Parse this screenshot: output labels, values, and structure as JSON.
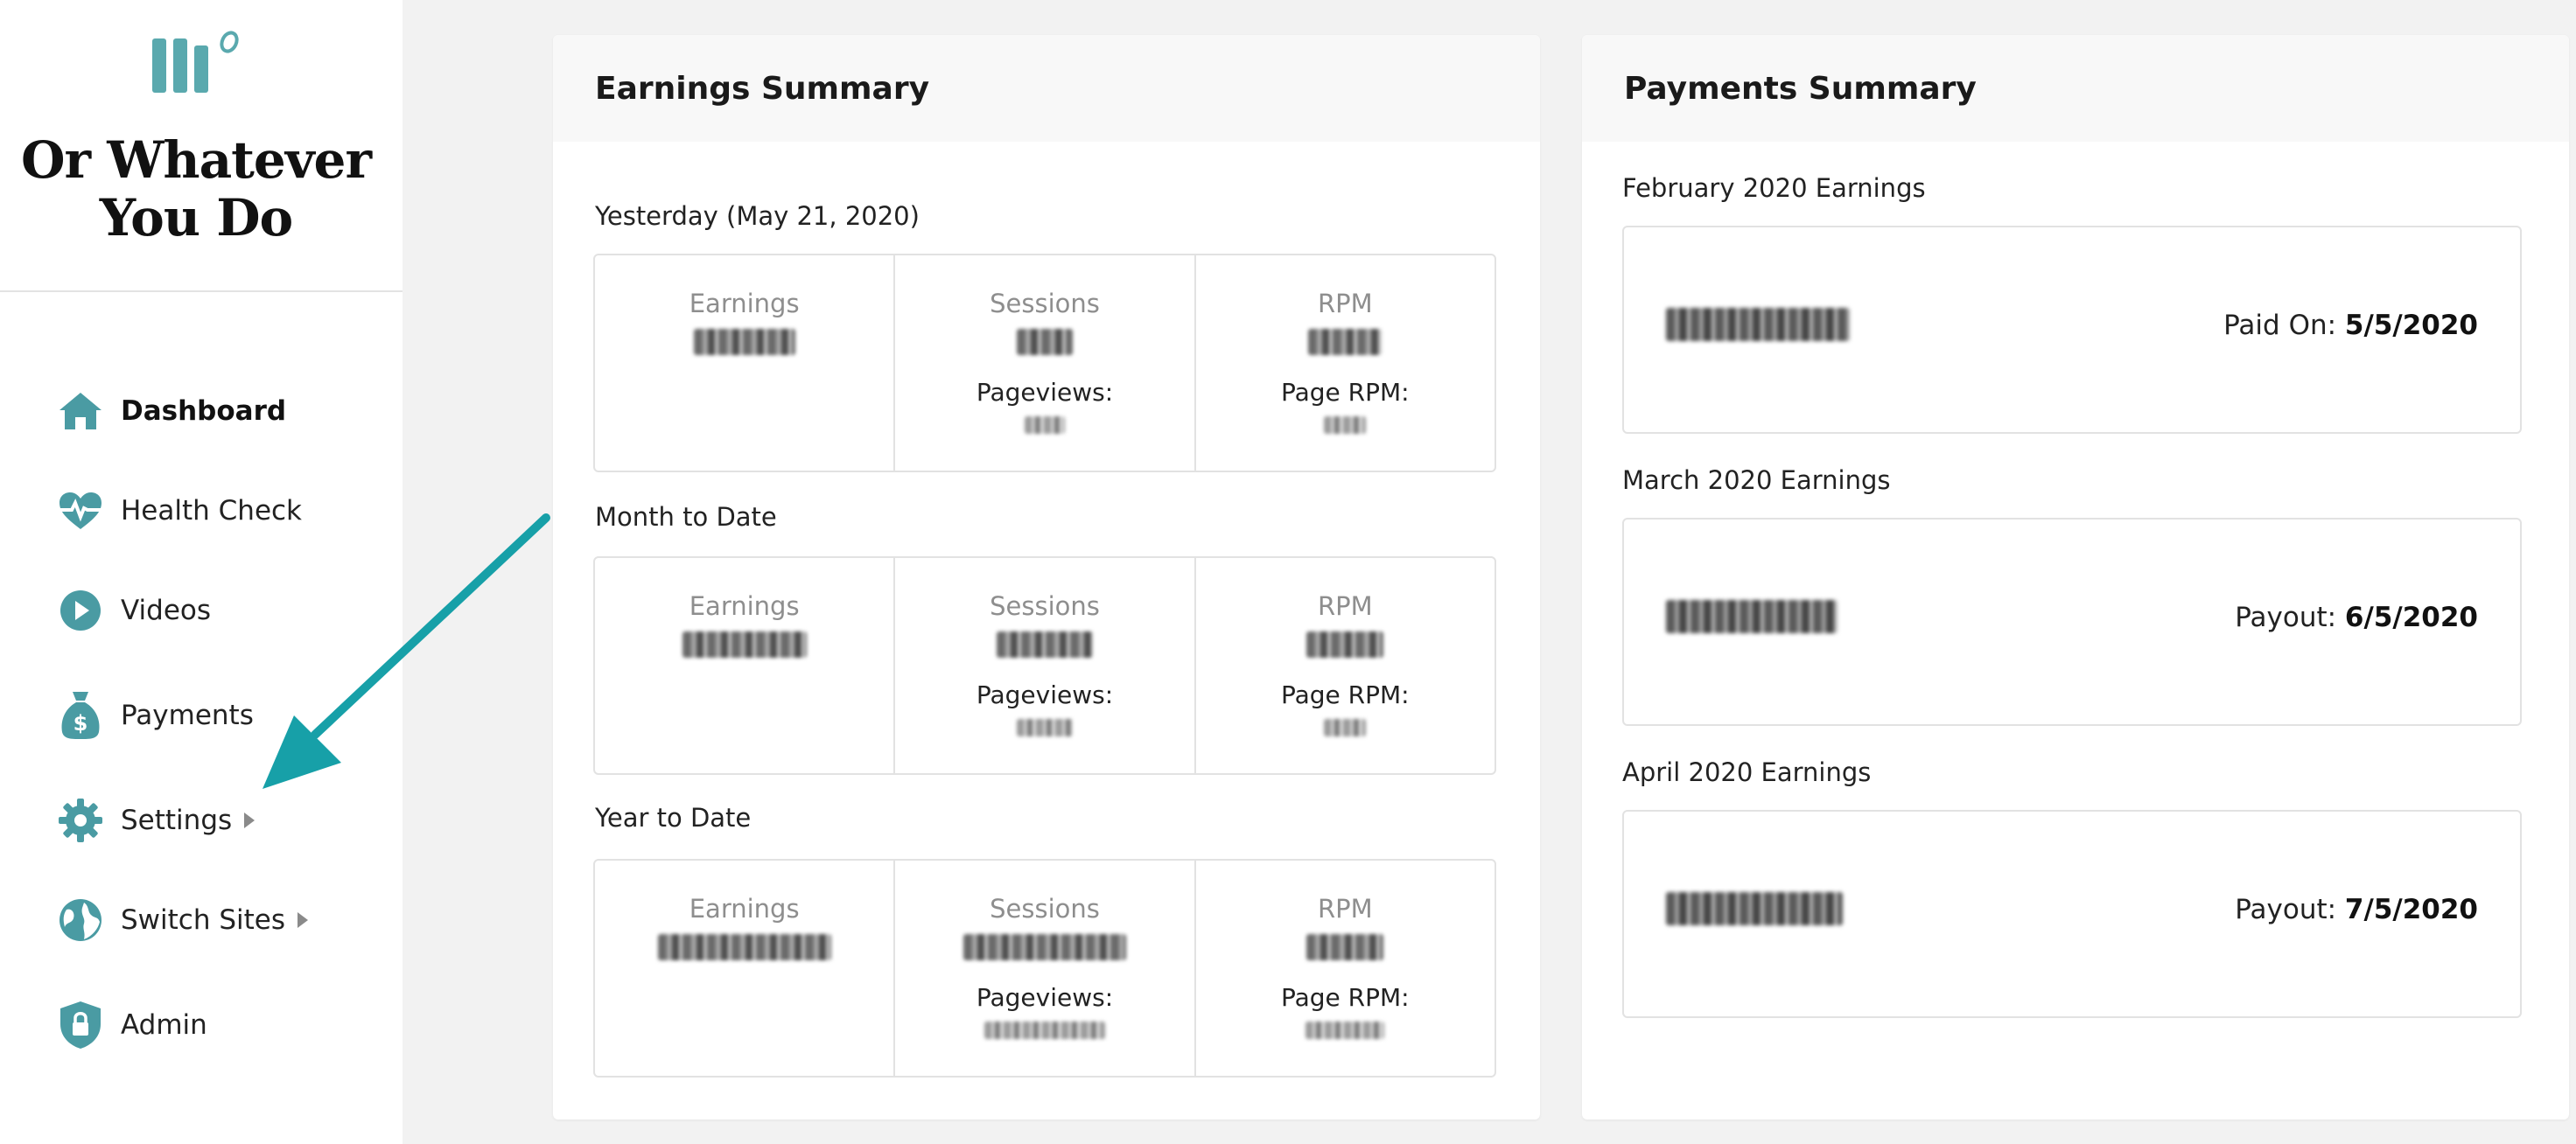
{
  "brand": {
    "site_name_line1": "Or Whatever",
    "site_name_line2": "You Do",
    "accent_color": "#4a9ba3"
  },
  "sidebar": {
    "items": [
      {
        "label": "Dashboard",
        "icon": "home-icon",
        "active": true
      },
      {
        "label": "Health Check",
        "icon": "heart-pulse-icon"
      },
      {
        "label": "Videos",
        "icon": "play-circle-icon"
      },
      {
        "label": "Payments",
        "icon": "money-bag-icon"
      },
      {
        "label": "Settings",
        "icon": "gear-icon",
        "has_submenu": true
      },
      {
        "label": "Switch Sites",
        "icon": "globe-icon",
        "has_submenu": true
      },
      {
        "label": "Admin",
        "icon": "shield-lock-icon"
      }
    ]
  },
  "earnings": {
    "title": "Earnings Summary",
    "sections": [
      {
        "label": "Yesterday (May 21, 2020)",
        "earnings_label": "Earnings",
        "sessions_label": "Sessions",
        "rpm_label": "RPM",
        "pageviews_label": "Pageviews:",
        "page_rpm_label": "Page RPM:"
      },
      {
        "label": "Month to Date",
        "earnings_label": "Earnings",
        "sessions_label": "Sessions",
        "rpm_label": "RPM",
        "pageviews_label": "Pageviews:",
        "page_rpm_label": "Page RPM:"
      },
      {
        "label": "Year to Date",
        "earnings_label": "Earnings",
        "sessions_label": "Sessions",
        "rpm_label": "RPM",
        "pageviews_label": "Pageviews:",
        "page_rpm_label": "Page RPM:"
      }
    ]
  },
  "payments": {
    "title": "Payments Summary",
    "months": [
      {
        "label": "February 2020 Earnings",
        "status_label": "Paid On:",
        "date": "5/5/2020"
      },
      {
        "label": "March 2020 Earnings",
        "status_label": "Payout:",
        "date": "6/5/2020"
      },
      {
        "label": "April 2020 Earnings",
        "status_label": "Payout:",
        "date": "7/5/2020"
      }
    ]
  }
}
